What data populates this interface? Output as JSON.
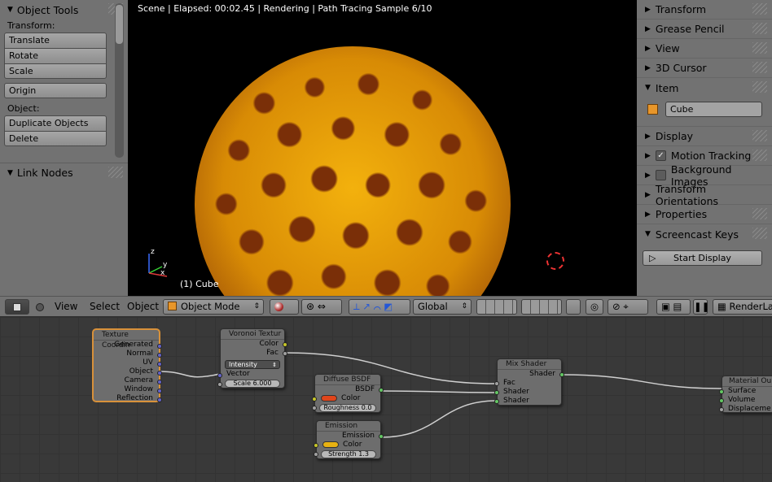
{
  "left_panel": {
    "header": "Object Tools",
    "transform_label": "Transform:",
    "transform_buttons": [
      "Translate",
      "Rotate",
      "Scale"
    ],
    "origin_button": "Origin",
    "object_label": "Object:",
    "object_buttons": [
      "Duplicate Objects",
      "Delete"
    ],
    "link_nodes": "Link Nodes"
  },
  "viewport": {
    "info": "Scene | Elapsed: 00:02.45 | Rendering | Path Tracing Sample 6/10",
    "object_label": "(1) Cube",
    "axis_labels": [
      "z",
      "y",
      "x"
    ]
  },
  "right_panel": {
    "sections": [
      "Transform",
      "Grease Pencil",
      "View",
      "3D Cursor",
      "Item"
    ],
    "item_name": "Cube",
    "display": "Display",
    "motion_tracking": "Motion Tracking",
    "background_images": "Background Images",
    "transform_orientations": "Transform Orientations",
    "properties": "Properties",
    "screencast_keys": "Screencast Keys",
    "start_display": "Start Display"
  },
  "node_header": {
    "menus": [
      "View",
      "Select",
      "Object"
    ],
    "mode": "Object Mode",
    "orientation": "Global",
    "render_layer": "RenderLa"
  },
  "nodes": {
    "texcoord": {
      "title": "Texture Coordin",
      "outputs": [
        "Generated",
        "Normal",
        "UV",
        "Object",
        "Camera",
        "Window",
        "Reflection"
      ]
    },
    "voronoi": {
      "title": "Voronoi Textur",
      "outputs": [
        "Color",
        "Fac"
      ],
      "dropdown": "Intensity",
      "input": "Vector",
      "scale": "Scale 6.000"
    },
    "diffuse": {
      "title": "Diffuse BSDF",
      "output": "BSDF",
      "color": "Color",
      "roughness": "Roughness 0.0"
    },
    "emission": {
      "title": "Emission",
      "output": "Emission",
      "color": "Color",
      "strength": "Strength 1.3"
    },
    "mix": {
      "title": "Mix Shader",
      "output": "Shader",
      "inputs": [
        "Fac",
        "Shader",
        "Shader"
      ]
    },
    "output": {
      "title": "Material Ou",
      "inputs": [
        "Surface",
        "Volume",
        "Displaceme"
      ]
    }
  },
  "colors": {
    "diffuse_swatch": "#e0451b",
    "emission_swatch": "#e8b212",
    "socket_yellow": "#c7c729",
    "socket_grey": "#a1a1a1",
    "socket_green": "#63c763",
    "socket_blue": "#6363c7"
  }
}
